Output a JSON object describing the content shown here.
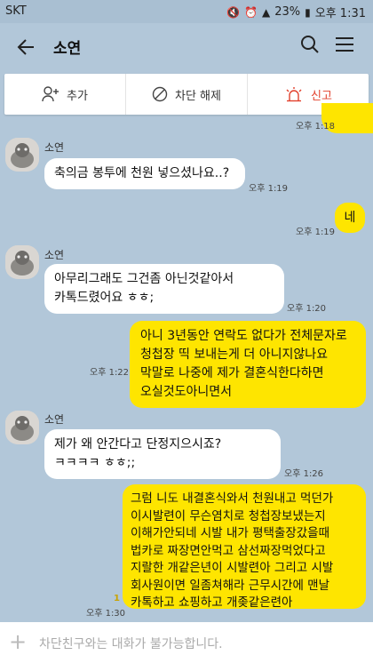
{
  "status": {
    "carrier": "SKT",
    "battery": "23%",
    "time": "오후 1:31"
  },
  "header": {
    "title": "소연"
  },
  "actions": {
    "add": "추가",
    "unblock": "차단 해제",
    "report": "신고"
  },
  "messages": [
    {
      "time": "오후 1:18"
    },
    {
      "sender": "소연",
      "text": "축의금 봉투에 천원 넣으셨나요..?",
      "time": "오후 1:19"
    },
    {
      "text": "네",
      "time": "오후 1:19"
    },
    {
      "sender": "소연",
      "text": "아무리그래도 그건좀 아닌것같아서 카톡드렸어요 ㅎㅎ;",
      "time": "오후 1:20"
    },
    {
      "text": "아니 3년동안 연락도 없다가 전체문자로 청첩장 띡 보내는게 더 아니지않나요 막말로 나중에 제가 결혼식한다하면 오실것도아니면서",
      "time": "오후 1:22"
    },
    {
      "sender": "소연",
      "text": "제가 왜 안간다고 단정지으시죠? ㅋㅋㅋㅋ ㅎㅎ;;",
      "time": "오후 1:26"
    },
    {
      "text": "그럼 니도 내결혼식와서 천원내고 먹던가 이시발련이 무슨염치로 청첩장보냈는지 이해가안되네 시발 내가 평택출장갔을때 법카로 짜장면안먹고 삼선짜장먹었다고 지랄한 개같은년이 시발련아 그리고 시발 회사원이면 일좀쳐해라 근무시간에 맨날 카톡하고 쇼핑하고 개좆같은련아",
      "time": "오후 1:30",
      "unread": "1"
    }
  ],
  "input": {
    "placeholder": "차단친구와는 대화가 불가능합니다."
  },
  "colors": {
    "background": "#b2c7d9",
    "outgoing": "#fee500",
    "incoming": "#ffffff",
    "report": "#e2412d"
  }
}
